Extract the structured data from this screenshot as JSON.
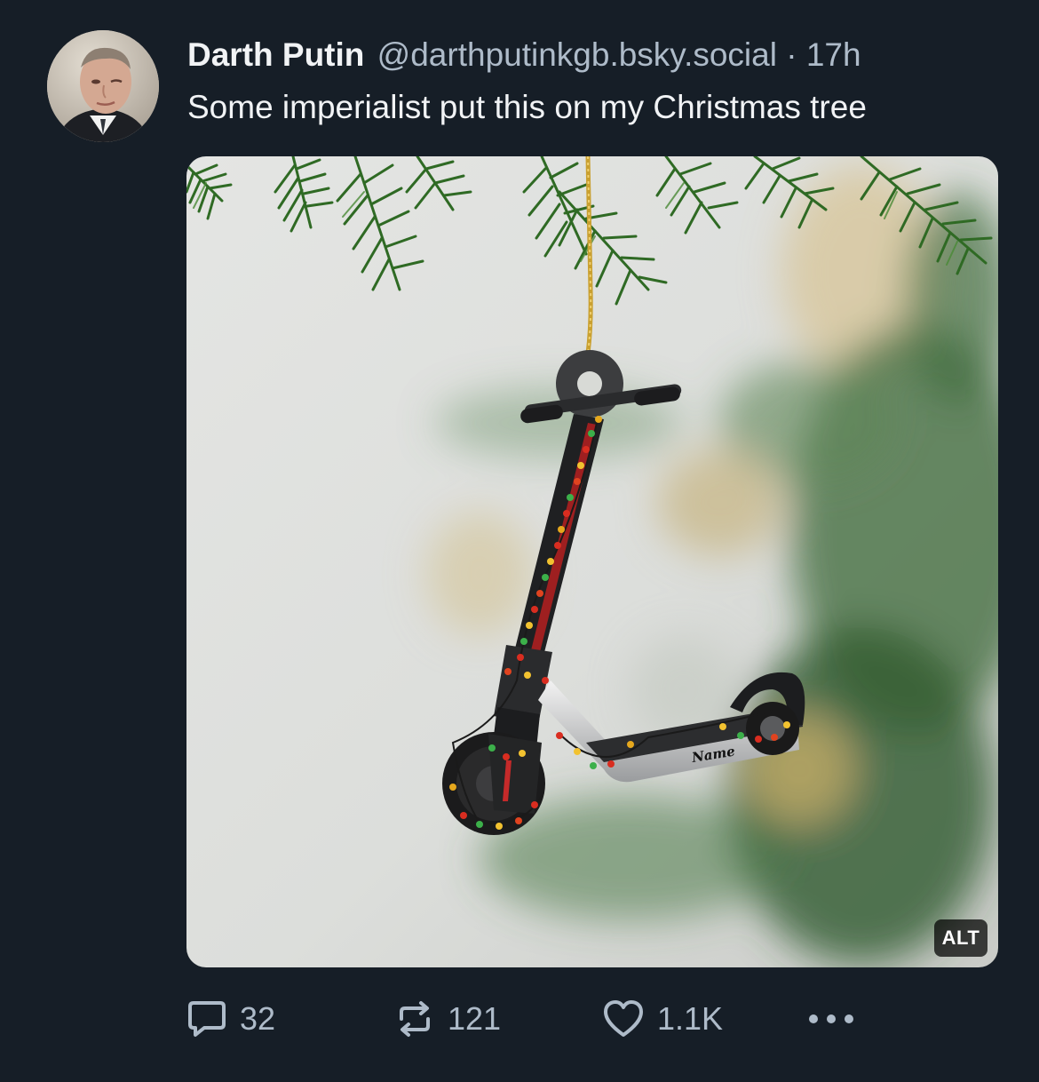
{
  "post": {
    "author": {
      "display_name": "Darth Putin",
      "handle": "@darthputinkgb.bsky.social"
    },
    "separator": "·",
    "time_ago": "17h",
    "text": "Some imperialist put this on my Christmas tree",
    "image": {
      "alt_label": "ALT",
      "ornament_text": "Name"
    },
    "actions": {
      "reply_count": "32",
      "repost_count": "121",
      "like_count": "1.1K"
    }
  },
  "colors": {
    "background": "#161e27",
    "text_primary": "#f1f3f5",
    "text_secondary": "#aebbc9"
  },
  "icons": {
    "reply": "speech-bubble-icon",
    "repost": "repost-arrows-icon",
    "like": "heart-icon",
    "more": "ellipsis-icon"
  }
}
